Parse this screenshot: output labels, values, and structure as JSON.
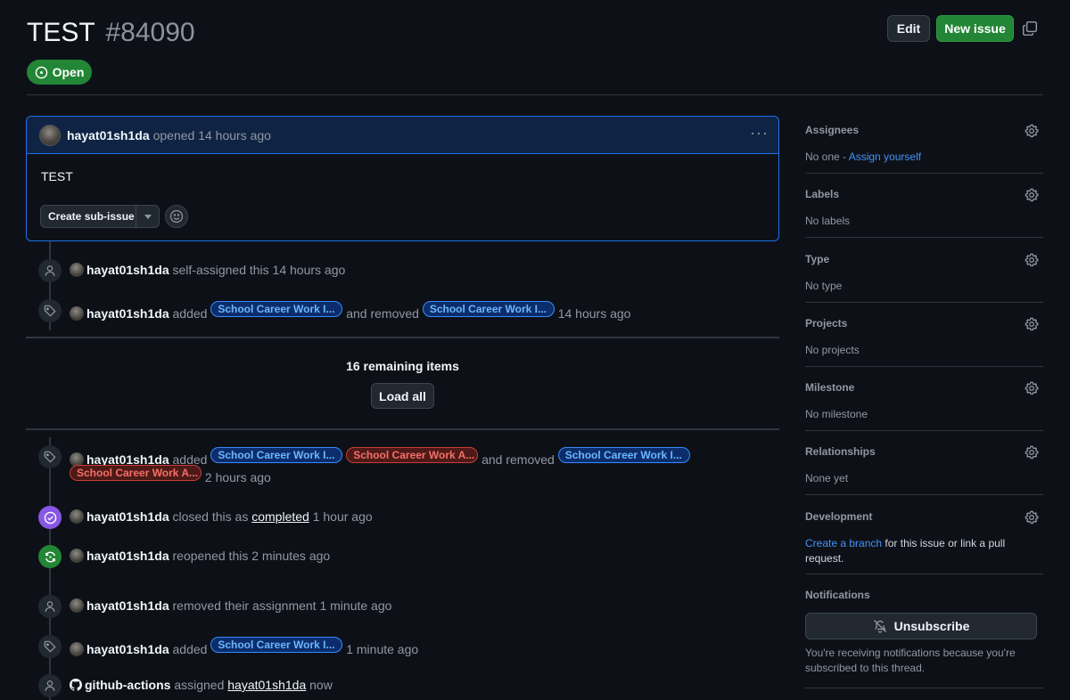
{
  "header": {
    "title": "TEST",
    "number": "#84090",
    "edit_label": "Edit",
    "new_issue_label": "New issue",
    "state": "Open"
  },
  "comment": {
    "author": "hayat01sh1da",
    "meta": "opened 14 hours ago",
    "body": "TEST",
    "subissue_label": "Create sub-issue"
  },
  "timeline_top": [
    {
      "actor": "hayat01sh1da",
      "text": "self-assigned this 14 hours ago"
    },
    {
      "actor": "hayat01sh1da",
      "added": "added",
      "label1": "School Career Work I...",
      "removed": "and removed",
      "label2": "School Career Work I...",
      "time": "14 hours ago"
    }
  ],
  "remaining": {
    "text": "16 remaining items",
    "button": "Load all"
  },
  "timeline_bottom": {
    "e1": {
      "actor": "hayat01sh1da",
      "added": "added",
      "label1": "School Career Work I...",
      "label2": "School Career Work A...",
      "removed": "and removed",
      "label3": "School Career Work I...",
      "label4": "School Career Work A...",
      "time": "2 hours ago"
    },
    "e2": {
      "actor": "hayat01sh1da",
      "pre": "closed this as",
      "link": "completed",
      "time": "1 hour ago"
    },
    "e3": {
      "actor": "hayat01sh1da",
      "text": "reopened this 2 minutes ago"
    },
    "e4": {
      "actor": "hayat01sh1da",
      "text": "removed their assignment 1 minute ago"
    },
    "e5": {
      "actor": "hayat01sh1da",
      "added": "added",
      "label1": "School Career Work I...",
      "time": "1 minute ago"
    },
    "e6": {
      "actor": "github-actions",
      "pre": "assigned",
      "link": "hayat01sh1da",
      "time": "now"
    }
  },
  "sidebar": {
    "assignees": {
      "title": "Assignees",
      "value": "No one - ",
      "link": "Assign yourself"
    },
    "labels": {
      "title": "Labels",
      "value": "No labels"
    },
    "type": {
      "title": "Type",
      "value": "No type"
    },
    "projects": {
      "title": "Projects",
      "value": "No projects"
    },
    "milestone": {
      "title": "Milestone",
      "value": "No milestone"
    },
    "relationships": {
      "title": "Relationships",
      "value": "None yet"
    },
    "development": {
      "title": "Development",
      "link": "Create a branch",
      "value": " for this issue or link a pull request."
    },
    "notifications": {
      "title": "Notifications",
      "button": "Unsubscribe",
      "note": "You're receiving notifications because you're subscribed to this thread."
    }
  },
  "colors": {
    "open_green": "#238636",
    "closed_purple": "#8957e5",
    "link_blue": "#4493f8",
    "focus_blue": "#1f6feb"
  }
}
